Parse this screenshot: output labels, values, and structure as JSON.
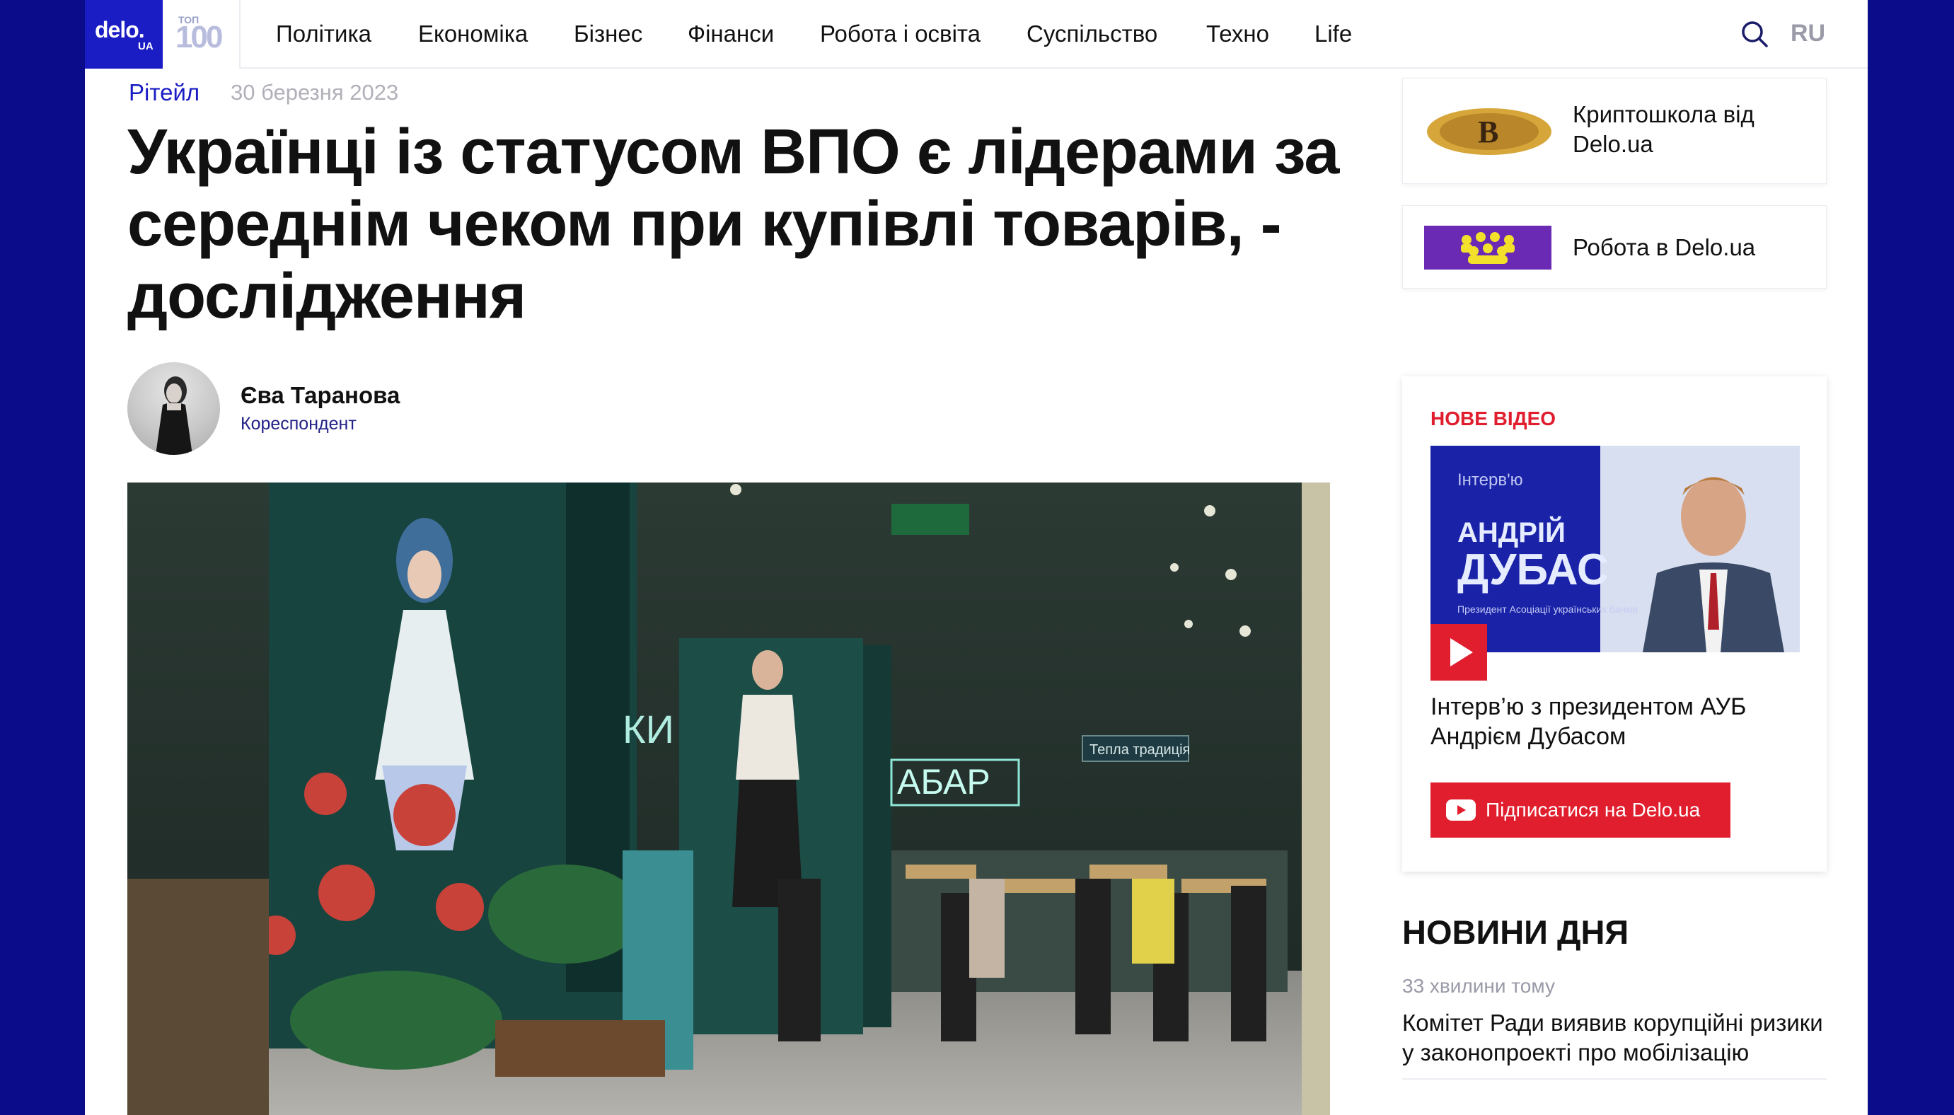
{
  "nav": {
    "logo_main": "delo.",
    "logo_ua": "UA",
    "top_small": "ТОП",
    "top_big": "100",
    "items": [
      "Політика",
      "Економіка",
      "Бізнес",
      "Фінанси",
      "Робота і освіта",
      "Суспільство",
      "Техно",
      "Life"
    ],
    "lang": "RU"
  },
  "article": {
    "category": "Рітейл",
    "date": "30 березня 2023",
    "title": "Українці із статусом ВПО є лідерами за середнім чеком при купівлі товарів, - дослідження",
    "author": "Єва Таранова",
    "role": "Кореспондент",
    "photo_sign_left": "КИ",
    "photo_sign_right": "АБАР",
    "photo_sign_small": "Тепла традиція"
  },
  "sidebar": {
    "promos": [
      {
        "label": "Криптошкола від Delo.ua"
      },
      {
        "label": "Робота в Delo.ua"
      }
    ],
    "video": {
      "heading": "НОВЕ ВІДЕО",
      "thumb_kicker": "Інтерв'ю",
      "thumb_name_first": "АНДРІЙ",
      "thumb_name_last": "ДУБАС",
      "thumb_caption": "Президент Асоціації українських банків",
      "title": "Інтерв’ю з президентом АУБ Андрієм Дубасом",
      "subscribe_label": "Підписатися на Delo.ua"
    },
    "news": {
      "heading": "НОВИНИ ДНЯ",
      "items": [
        {
          "time": "33 хвилини тому",
          "title": "Комітет Ради виявив корупційні ризики у законопроекті про мобілізацію"
        }
      ]
    }
  },
  "colors": {
    "brand_blue": "#1a1cc4",
    "frame_blue": "#0a0c8a",
    "accent_red": "#e01e2e"
  }
}
